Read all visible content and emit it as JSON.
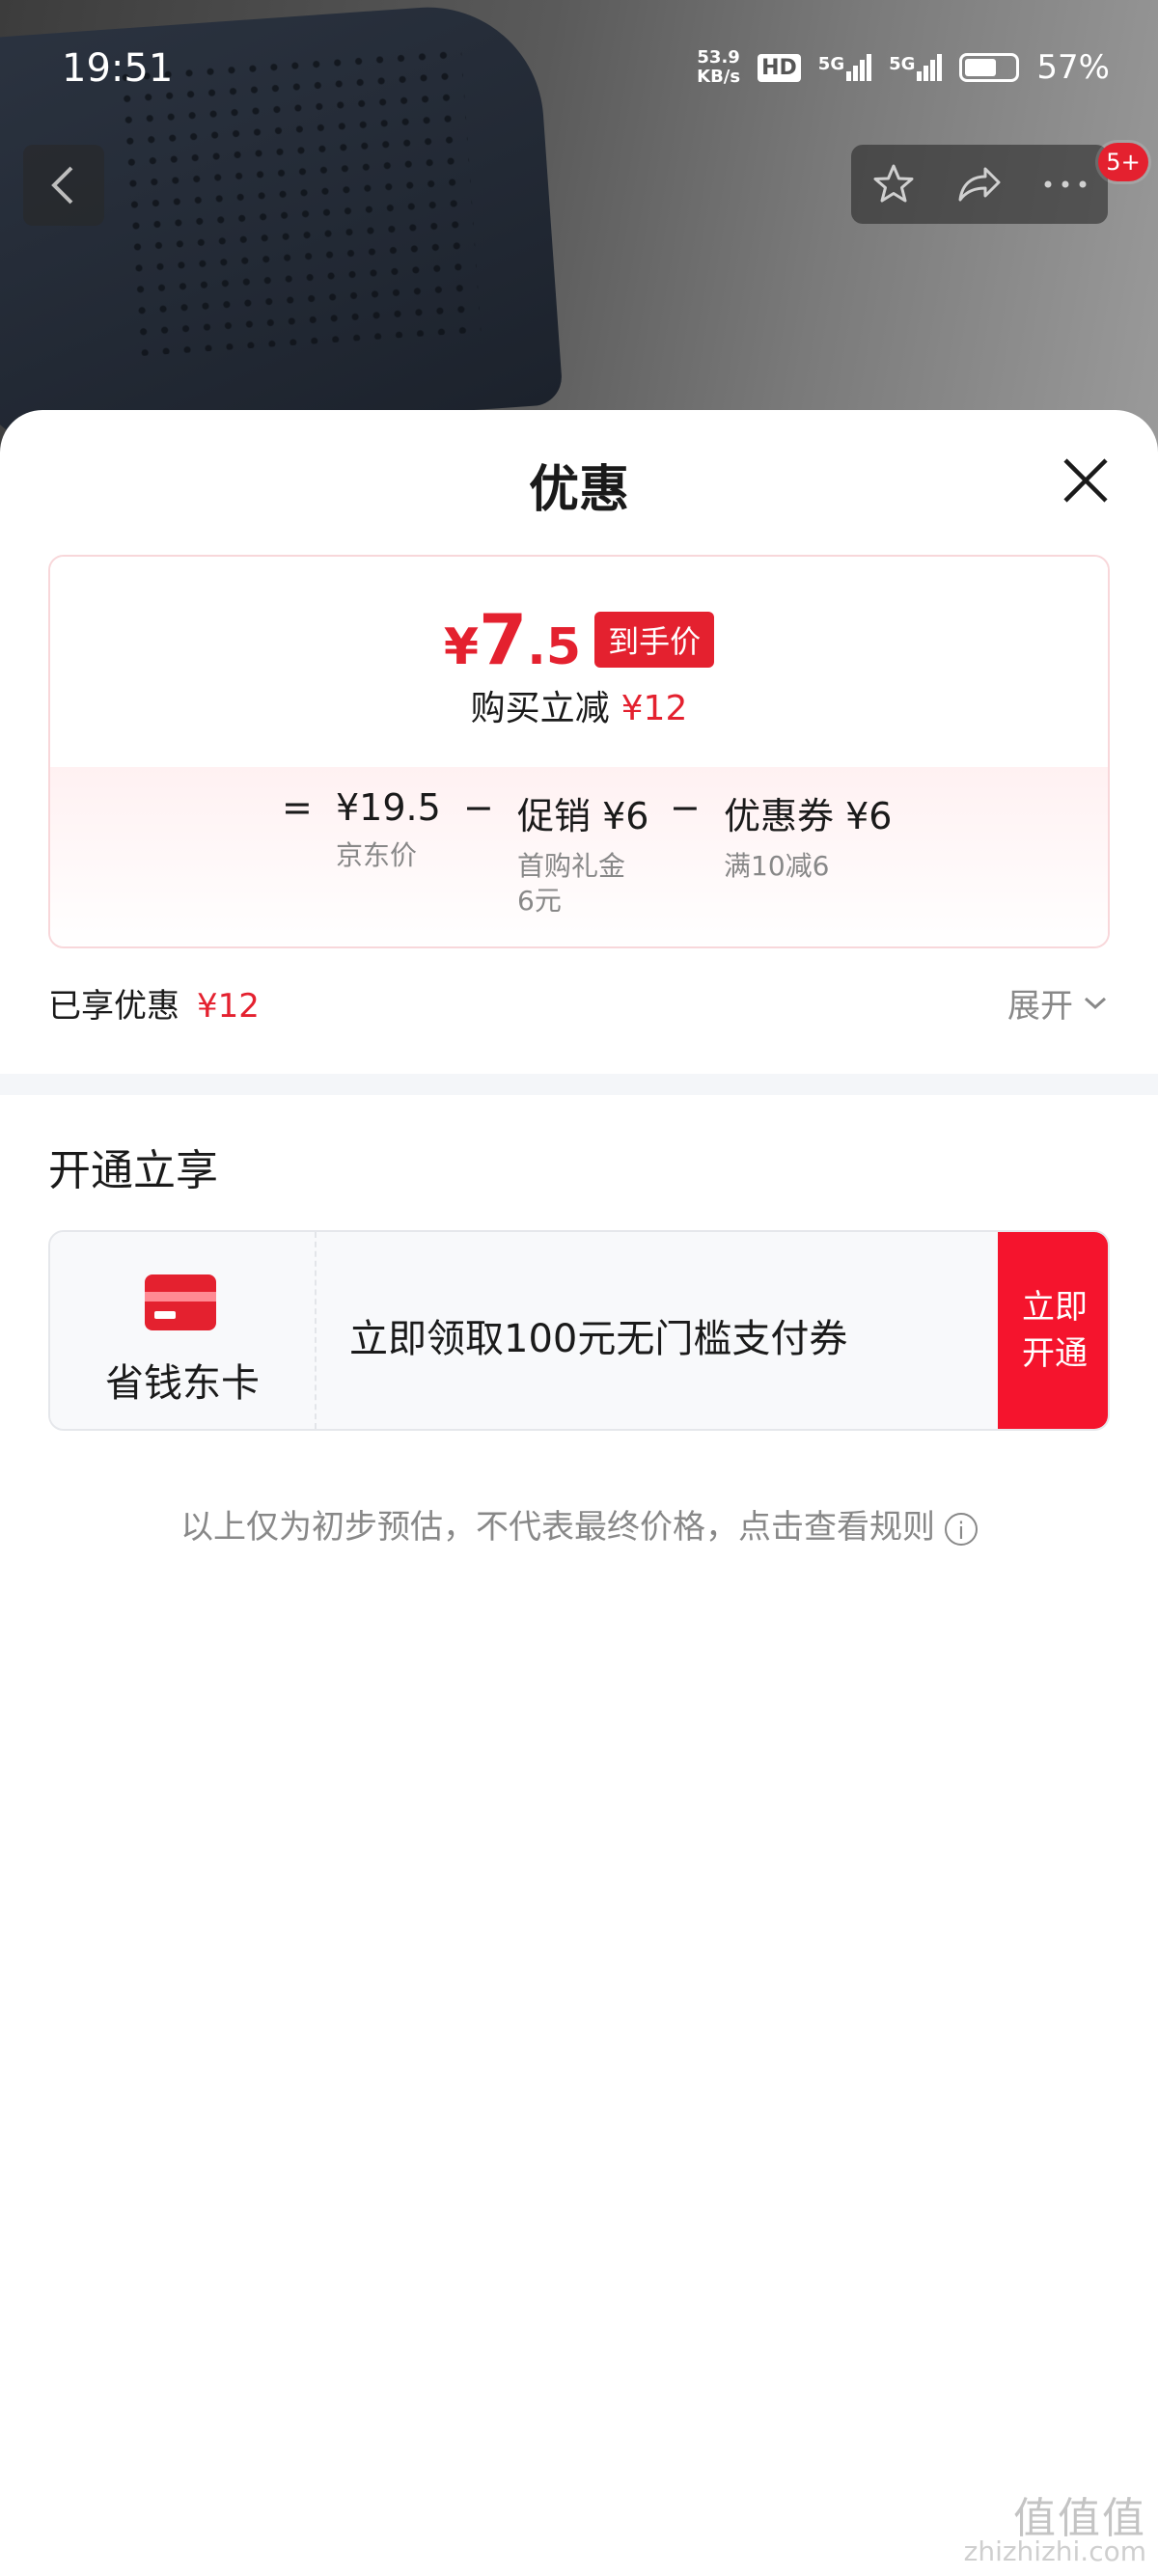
{
  "status_bar": {
    "time": "19:51",
    "net_speed_value": "53.9",
    "net_speed_unit": "KB/s",
    "hd_label": "HD",
    "signal1_label": "5G",
    "signal2_label": "5G",
    "battery_percent": "57%"
  },
  "nav": {
    "back_icon": "chevron-left-icon",
    "favorite_icon": "star-icon",
    "share_icon": "share-icon",
    "more_icon": "more-icon",
    "badge": "5+"
  },
  "sheet": {
    "title": "优惠",
    "close_icon": "close-icon"
  },
  "price_card": {
    "final_currency": "¥",
    "final_integer": "7",
    "final_decimal": ".5",
    "final_tag": "到手价",
    "reduce_label": "购买立减",
    "reduce_amount": "¥12",
    "equals": "=",
    "jd_price": "¥19.5",
    "jd_price_label": "京东价",
    "minus1": "−",
    "promo": "促销 ¥6",
    "promo_desc_line1": "首购礼金",
    "promo_desc_line2": "6元",
    "minus2": "−",
    "coupon": "优惠券 ¥6",
    "coupon_desc": "满10减6"
  },
  "enjoyed": {
    "label": "已享优惠",
    "amount": "¥12",
    "expand_label": "展开"
  },
  "open_section": {
    "title": "开通立享",
    "card_name": "省钱东卡",
    "offer_text": "立即领取100元无门槛支付券",
    "button_line1": "立即",
    "button_line2": "开通"
  },
  "disclaimer": {
    "text": "以上仅为初步预估，不代表最终价格，点击查看规则",
    "info_icon": "info-icon"
  },
  "watermark": {
    "line1": "值值值",
    "line2": "zhizhizhi.com"
  },
  "colors": {
    "accent": "#e4212f",
    "button": "#f5142d"
  }
}
